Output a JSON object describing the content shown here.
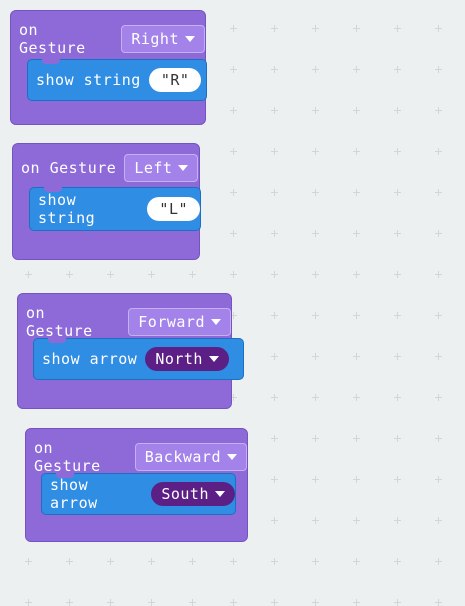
{
  "blocks": [
    {
      "event_label": "on Gesture",
      "gesture": "Right",
      "action": "show string",
      "value": "R",
      "value_kind": "string"
    },
    {
      "event_label": "on Gesture",
      "gesture": "Left",
      "action": "show string",
      "value": "L",
      "value_kind": "string"
    },
    {
      "event_label": "on Gesture",
      "gesture": "Forward",
      "action": "show arrow",
      "value": "North",
      "value_kind": "arrow"
    },
    {
      "event_label": "on Gesture",
      "gesture": "Backward",
      "action": "show arrow",
      "value": "South",
      "value_kind": "arrow"
    }
  ],
  "quotes": {
    "open": "\"",
    "close": "\""
  },
  "colors": {
    "event": "#8e6ad9",
    "statement": "#2f8de4",
    "arrow_pill": "#5b1f86",
    "background": "#ecf0f1"
  }
}
